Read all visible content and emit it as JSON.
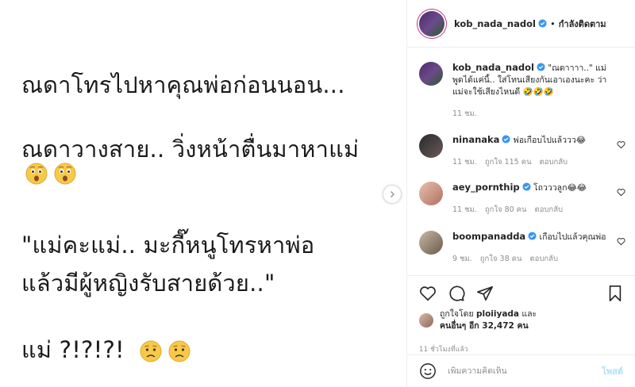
{
  "post": {
    "line1": "ณดาโทรไปหาคุณพ่อก่อนนอน...",
    "line2": "ณดาวางสาย.. วิ่งหน้าตื่นมาหาแม่",
    "line3": "\"แม่คะแม่.. มะกี๊หนูโทรหาพ่อ",
    "line4": "แล้วมีผู้หญิงรับสายด้วย..\"",
    "line5": "แม่ ?!?!?!"
  },
  "header": {
    "username": "kob_nada_nadol",
    "separator": "•",
    "following_label": "กำลังติดตาม"
  },
  "comments": [
    {
      "username": "kob_nada_nadol",
      "text": "\"ณดาาาา..\" แม่พูดได้แค่นี้.. ใส่โทนเสียงกันเอาเองนะคะ ว่าแม่จะใช้เสียงไหนดี 🤣🤣🤣",
      "time": "11 ชม.",
      "likes": "",
      "reply": ""
    },
    {
      "username": "ninanaka",
      "text": "พ่อเกือบไปแล้ววว😂",
      "time": "11 ชม.",
      "likes": "ถูกใจ 115 คน",
      "reply": "ตอบกลับ"
    },
    {
      "username": "aey_pornthip",
      "text": "โถวววลูก😂😂",
      "time": "11 ชม.",
      "likes": "ถูกใจ 80 คน",
      "reply": "ตอบกลับ"
    },
    {
      "username": "boompanadda",
      "text": "เกือบไปแล้วคุณพ่อ",
      "time": "9 ชม.",
      "likes": "ถูกใจ 38 คน",
      "reply": "ตอบกลับ"
    }
  ],
  "likes": {
    "prefix": "ถูกใจโดย",
    "user": "ploiiyada",
    "and": "และ",
    "others": "คนอื่นๆ อีก 32,472 คน"
  },
  "timestamp": "11 ชั่วโมงที่แล้ว",
  "add_comment": {
    "placeholder": "เพิ่มความคิดเห็น",
    "post_label": "โพสต์"
  },
  "colors": {
    "verified": "#3897f0",
    "post_button": "#b2dffc",
    "meta_text": "#8e8e8e",
    "story_ring": "#c13584"
  },
  "icons": [
    "chevron-right-icon",
    "verified-badge-icon",
    "heart-icon",
    "comment-icon",
    "share-icon",
    "bookmark-icon",
    "emoji-icon",
    "astonished-emoji-icon",
    "worried-emoji-icon"
  ]
}
